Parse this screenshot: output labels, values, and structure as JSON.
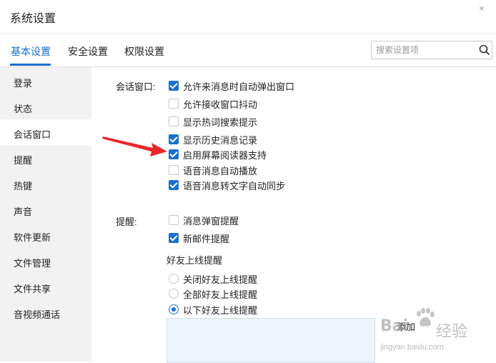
{
  "window": {
    "title": "系统设置",
    "close_label": "×"
  },
  "tabs": [
    {
      "label": "基本设置",
      "active": true
    },
    {
      "label": "安全设置",
      "active": false
    },
    {
      "label": "权限设置",
      "active": false
    }
  ],
  "search": {
    "placeholder": "搜索设置项",
    "icon": "search-icon"
  },
  "sidebar": {
    "items": [
      {
        "label": "登录",
        "active": false
      },
      {
        "label": "状态",
        "active": false
      },
      {
        "label": "会话窗口",
        "active": true
      },
      {
        "label": "提醒",
        "active": false
      },
      {
        "label": "热键",
        "active": false
      },
      {
        "label": "声音",
        "active": false
      },
      {
        "label": "软件更新",
        "active": false
      },
      {
        "label": "文件管理",
        "active": false
      },
      {
        "label": "文件共享",
        "active": false
      },
      {
        "label": "音视频通话",
        "active": false
      }
    ]
  },
  "chat_window": {
    "label": "会话窗口:",
    "options": [
      {
        "label": "允许来消息时自动弹出窗口",
        "checked": true
      },
      {
        "label": "允许接收窗口抖动",
        "checked": false
      },
      {
        "label": "显示热词搜索提示",
        "checked": false
      },
      {
        "label": "显示历史消息记录",
        "checked": true
      },
      {
        "label": "启用屏幕阅读器支持",
        "checked": true
      },
      {
        "label": "语音消息自动播放",
        "checked": false
      },
      {
        "label": "语音消息转文字自动同步",
        "checked": true
      }
    ]
  },
  "reminder": {
    "label": "提醒:",
    "options": [
      {
        "label": "消息弹窗提醒",
        "checked": false
      },
      {
        "label": "新邮件提醒",
        "checked": true
      }
    ],
    "friend_online": {
      "heading": "好友上线提醒",
      "radios": [
        {
          "label": "关闭好友上线提醒",
          "selected": false
        },
        {
          "label": "全部好友上线提醒",
          "selected": false
        },
        {
          "label": "以下好友上线提醒",
          "selected": true
        }
      ],
      "add_label": "添加"
    }
  },
  "watermark": {
    "logo": "Bai",
    "brand": "经验",
    "url": "jingyan.baidu.com"
  },
  "colors": {
    "accent": "#1a6fd1",
    "sidebar_bg": "#f2f2f2",
    "arrow": "#e8262a",
    "list_bg": "#edf5fb"
  }
}
